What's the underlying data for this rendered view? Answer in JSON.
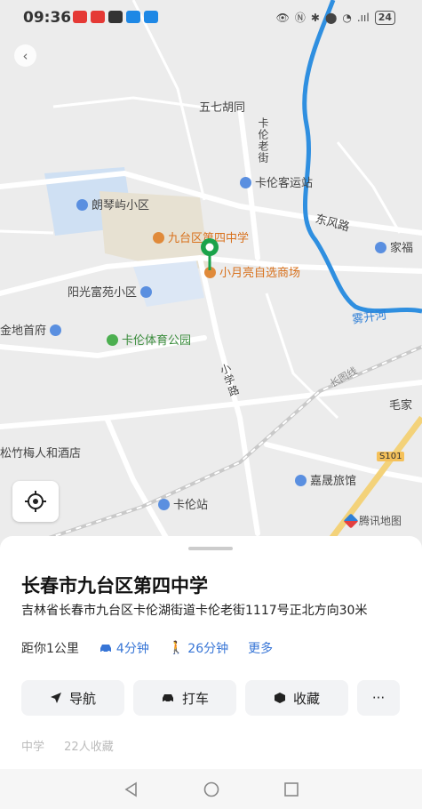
{
  "status_bar": {
    "time": "09:36",
    "signal": ".ııl",
    "battery": "24"
  },
  "map": {
    "labels": {
      "wuqi": "五七胡同",
      "kalun_laojie": "卡伦老街",
      "keyun": "卡伦客运站",
      "langqin": "朗琴屿小区",
      "dongfeng": "东风路",
      "jiafu": "家福",
      "school": "九台区第四中学",
      "market": "小月亮自选商场",
      "yangguang": "阳光富苑小区",
      "jindi": "金地首府",
      "tiyu": "卡伦体育公园",
      "xiaoxue": "小学路",
      "yinkaihe": "雾开河",
      "changtu": "长图线",
      "maojia": "毛家",
      "songzhu": "松竹梅人和酒店",
      "jiasheng": "嘉晟旅馆",
      "road_shield": "S101",
      "kalun_station": "卡伦站",
      "watermark": "腾讯地图"
    }
  },
  "place": {
    "title": "长春市九台区第四中学",
    "address": "吉林省长春市九台区卡伦湖街道卡伦老街1117号正北方向30米",
    "distance": "距你1公里",
    "drive_time": "4分钟",
    "walk_time": "26分钟",
    "more": "更多"
  },
  "actions": {
    "navigate": "导航",
    "taxi": "打车",
    "favorite": "收藏",
    "more": "···"
  },
  "tags": {
    "category": "中学",
    "favorites": "22人收藏"
  },
  "colors": {
    "accent_blue": "#3775d6",
    "pin_green": "#1aa34a",
    "river_blue": "#2f8fe0"
  }
}
